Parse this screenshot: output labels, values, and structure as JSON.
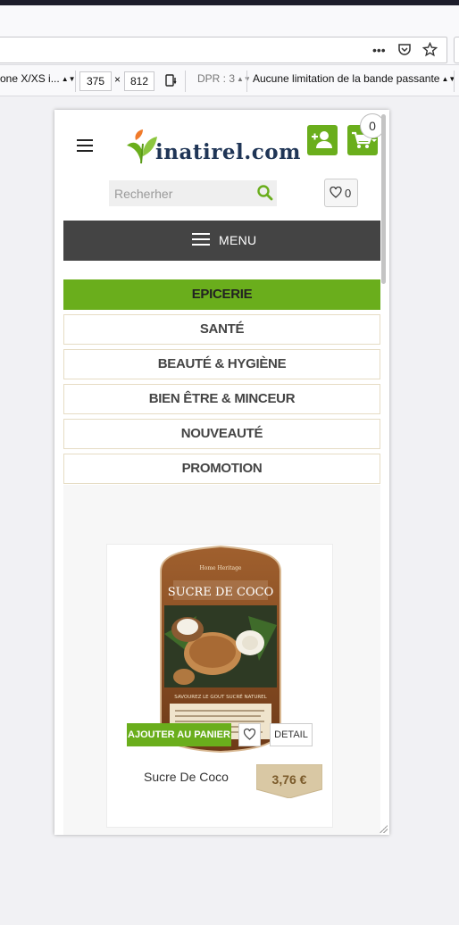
{
  "browser": {
    "device": "one X/XS i...",
    "width": "375",
    "times": "×",
    "height": "812",
    "dpr": "DPR : 3",
    "throttle": "Aucune limitation de la bande passante",
    "menu_dots": "•••"
  },
  "header": {
    "logo_text": "inatirel.com",
    "cart_count": "0"
  },
  "search": {
    "placeholder": "Recherher"
  },
  "wishlist": {
    "count": "0"
  },
  "menu": {
    "label": "MENU"
  },
  "categories": [
    {
      "label": "EPICERIE",
      "active": true
    },
    {
      "label": "SANTÉ",
      "active": false
    },
    {
      "label": "BEAUTÉ & HYGIÈNE",
      "active": false
    },
    {
      "label": "BIEN ÊTRE & MINCEUR",
      "active": false
    },
    {
      "label": "NOUVEAUTÉ",
      "active": false
    },
    {
      "label": "PROMOTION",
      "active": false
    }
  ],
  "product": {
    "brand": "Home Heritage",
    "label_title": "SUCRE DE COCO",
    "tagline": "SAVOUREZ LE GOUT SUCRÉ NATUREL",
    "add_to_cart": "AJOUTER AU PANIER",
    "detail": "DETAIL",
    "name": "Sucre De Coco",
    "price": "3,76 €"
  },
  "colors": {
    "accent": "#6aae1c",
    "menu_bg": "#444444",
    "logo_text": "#1f3556"
  }
}
